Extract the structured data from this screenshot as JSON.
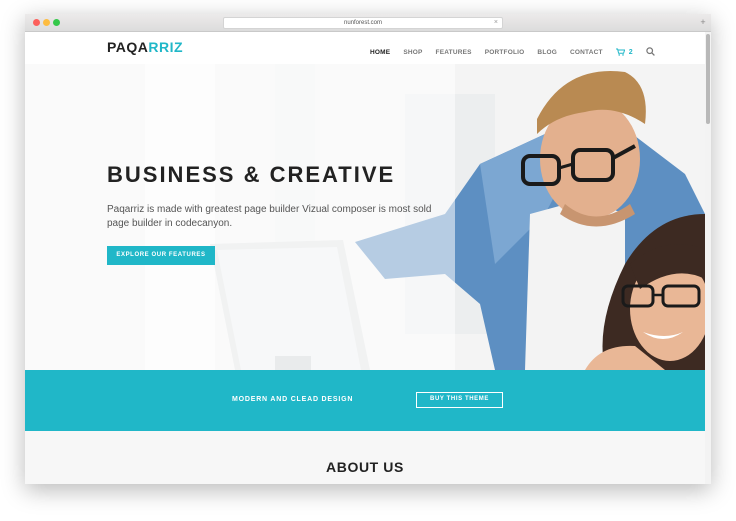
{
  "browser": {
    "url": "nunforest.com",
    "close_glyph": "×",
    "new_tab_glyph": "+"
  },
  "site": {
    "logo_main": "PAQA",
    "logo_accent": "RRIZ",
    "nav": [
      "HOME",
      "SHOP",
      "FEATURES",
      "PORTFOLIO",
      "BLOG",
      "CONTACT"
    ],
    "cart_count": "2",
    "hero": {
      "title": "BUSINESS & CREATIVE",
      "text": "Paqarriz is made with greatest page builder Vizual composer is most sold page builder in codecanyon.",
      "button": "EXPLORE OUR FEATURES"
    },
    "banner": {
      "text": "MODERN AND CLEAD DESIGN",
      "button": "BUY THIS THEME"
    },
    "about_title": "ABOUT US"
  },
  "colors": {
    "accent": "#20b7c8",
    "dark_text": "#222222",
    "nav_text": "#777777"
  },
  "icons": {
    "cart": "cart-icon",
    "search": "search-icon"
  }
}
